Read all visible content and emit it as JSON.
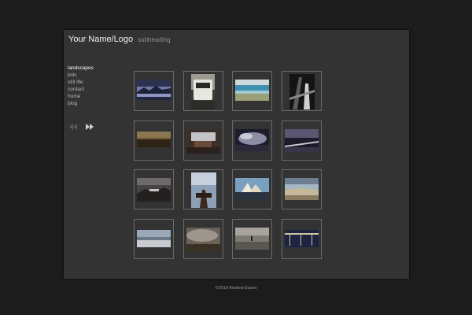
{
  "header": {
    "logo": "Your Name/Logo",
    "subheading": "subheading"
  },
  "nav": {
    "items": [
      {
        "label": "landscapes",
        "active": true
      },
      {
        "label": "kids",
        "active": false
      },
      {
        "label": "still life",
        "active": false
      },
      {
        "label": "contact",
        "active": false
      },
      {
        "label": "home",
        "active": false
      },
      {
        "label": "blog",
        "active": false
      }
    ]
  },
  "pager": {
    "prev_icon": "double-chevron-left-icon",
    "next_icon": "double-chevron-right-icon"
  },
  "gallery": {
    "thumbnails": [
      {
        "subject": "mountain-lake"
      },
      {
        "subject": "caravan"
      },
      {
        "subject": "beach-sea"
      },
      {
        "subject": "pier-posts"
      },
      {
        "subject": "sunset-horizon"
      },
      {
        "subject": "room-table"
      },
      {
        "subject": "storm-clouds"
      },
      {
        "subject": "fence-field"
      },
      {
        "subject": "rocky-shore"
      },
      {
        "subject": "jetty"
      },
      {
        "subject": "tents-ice"
      },
      {
        "subject": "dunes"
      },
      {
        "subject": "flat-shore"
      },
      {
        "subject": "cloudy-field"
      },
      {
        "subject": "figure-beach"
      },
      {
        "subject": "railing-dusk"
      }
    ]
  },
  "footer": {
    "copyright": "©2010 Andrew Eaves"
  },
  "colors": {
    "background": "#1c1c1c",
    "panel": "#333333",
    "thumb_border": "#6a6a6a",
    "nav_text": "#b9b9b9"
  }
}
